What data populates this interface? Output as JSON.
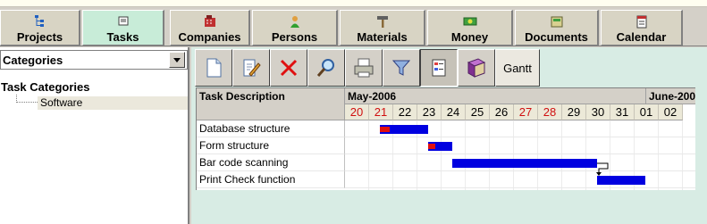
{
  "nav": {
    "tabs": [
      {
        "label": "Projects",
        "icon": "projects-icon",
        "active": false
      },
      {
        "label": "Tasks",
        "icon": "tasks-icon",
        "active": true
      },
      {
        "label": "Companies",
        "icon": "companies-icon",
        "active": false
      },
      {
        "label": "Persons",
        "icon": "persons-icon",
        "active": false
      },
      {
        "label": "Materials",
        "icon": "materials-icon",
        "active": false
      },
      {
        "label": "Money",
        "icon": "money-icon",
        "active": false
      },
      {
        "label": "Documents",
        "icon": "documents-icon",
        "active": false
      },
      {
        "label": "Calendar",
        "icon": "calendar-icon",
        "active": false
      }
    ]
  },
  "sidebar": {
    "combo_label": "Categories",
    "tree_root": "Task Categories",
    "tree_child": "Software"
  },
  "toolbar": {
    "buttons": [
      {
        "icon": "new-document-icon"
      },
      {
        "icon": "edit-icon"
      },
      {
        "icon": "delete-icon"
      },
      {
        "icon": "search-icon"
      },
      {
        "icon": "print-icon"
      },
      {
        "icon": "filter-icon"
      },
      {
        "icon": "details-view-icon",
        "pressed": true
      },
      {
        "icon": "book-icon"
      }
    ],
    "gantt_label": "Gantt"
  },
  "gantt": {
    "desc_header": "Task Description",
    "months": [
      {
        "label": "May-2006"
      },
      {
        "label": "June-2006"
      }
    ],
    "days": [
      {
        "label": "20",
        "weekend": true
      },
      {
        "label": "21",
        "weekend": true
      },
      {
        "label": "22",
        "weekend": false
      },
      {
        "label": "23",
        "weekend": false
      },
      {
        "label": "24",
        "weekend": false
      },
      {
        "label": "25",
        "weekend": false
      },
      {
        "label": "26",
        "weekend": false
      },
      {
        "label": "27",
        "weekend": true
      },
      {
        "label": "28",
        "weekend": true
      },
      {
        "label": "29",
        "weekend": false
      },
      {
        "label": "30",
        "weekend": false
      },
      {
        "label": "31",
        "weekend": false
      },
      {
        "label": "01",
        "weekend": false
      },
      {
        "label": "02",
        "weekend": false
      }
    ],
    "tasks": [
      {
        "name": "Database structure",
        "start": "21",
        "end": "22",
        "progress": 0.2
      },
      {
        "name": "Form structure",
        "start": "23",
        "end": "23",
        "progress": 0.3
      },
      {
        "name": "Bar code scanning",
        "start": "24",
        "end": "29",
        "progress": 0
      },
      {
        "name": "Print Check function",
        "start": "30",
        "end": "31",
        "progress": 0
      }
    ],
    "dependency": {
      "from": "Bar code scanning",
      "to": "Print Check function"
    }
  }
}
